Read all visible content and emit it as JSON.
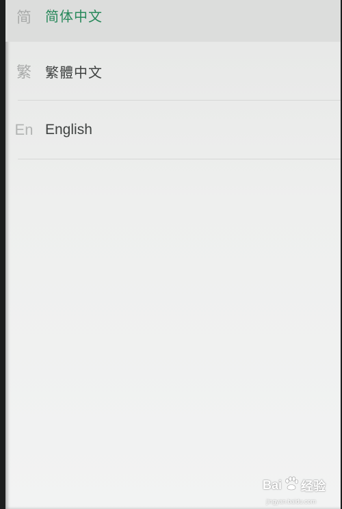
{
  "languages": [
    {
      "icon": "简",
      "label": "简体中文",
      "selected": true,
      "selected_mark": "'"
    },
    {
      "icon": "繁",
      "label": "繁體中文",
      "selected": false
    },
    {
      "icon": "En",
      "label": "English",
      "selected": false
    }
  ],
  "watermark": {
    "brand_left": "Bai",
    "brand_right": "经验",
    "url": "jingyan.baidu.com"
  },
  "colors": {
    "selected_text": "#27885a",
    "text": "#3f4241",
    "icon": "#a9abaa"
  }
}
